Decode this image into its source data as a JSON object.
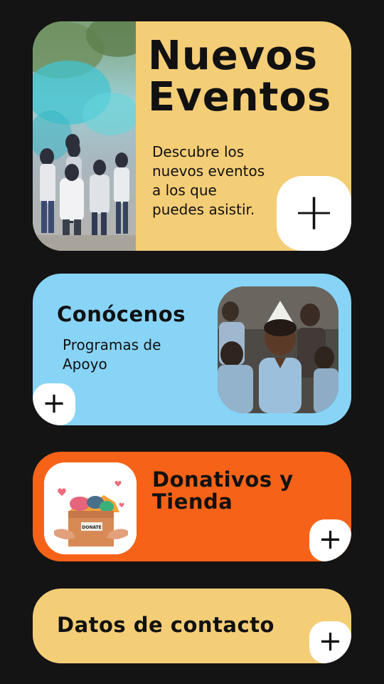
{
  "cards": {
    "events": {
      "title_line1": "Nuevos",
      "title_line2": "Eventos",
      "desc_lines": [
        "Descubre los",
        "nuevos eventos",
        "a los que",
        "puedes asistir."
      ],
      "button_label": "+",
      "color": "#f4cd77"
    },
    "about": {
      "title": "Conócenos",
      "subtitle_lines": [
        "Programas de",
        "Apoyo"
      ],
      "button_label": "+",
      "color": "#88d4f7"
    },
    "donations": {
      "title_line1": "Donativos y",
      "title_line2": "Tienda",
      "image_text": "DONATE",
      "button_label": "+",
      "color": "#f66318"
    },
    "contact": {
      "title": "Datos de contacto",
      "button_label": "+",
      "color": "#f4cd77"
    }
  }
}
